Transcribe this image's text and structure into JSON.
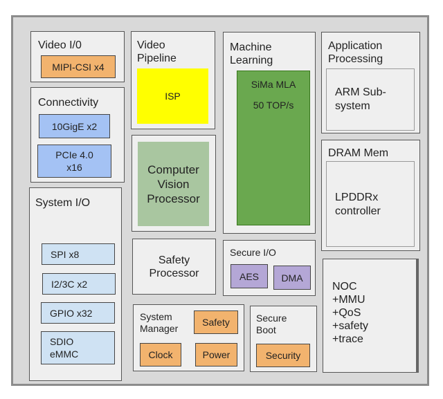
{
  "diagram": {
    "blocks": {
      "video_io": {
        "title": "Video I/0",
        "items": [
          "MIPI-CSI x4"
        ]
      },
      "connectivity": {
        "title": "Connectivity",
        "items": [
          "10GigE x2",
          "PCIe 4.0\nx16"
        ]
      },
      "system_io": {
        "title": "System I/O",
        "items": [
          "SPI x8",
          "I2/3C x2",
          "GPIO x32",
          "SDIO\neMMC"
        ]
      },
      "video_pipeline": {
        "title": "Video\nPipeline",
        "items": [
          "ISP"
        ]
      },
      "computer_vision": {
        "label": "Computer\nVision\nProcessor"
      },
      "safety_processor": {
        "label": "Safety\nProcessor"
      },
      "system_manager": {
        "title": "System\nManager",
        "items": [
          "Safety",
          "Clock",
          "Power"
        ]
      },
      "machine_learning": {
        "title": "Machine\nLearning",
        "mla_name": "SiMa MLA",
        "mla_perf": "50 TOP/s"
      },
      "secure_io": {
        "title": "Secure I/O",
        "items": [
          "AES",
          "DMA"
        ]
      },
      "secure_boot": {
        "title": "Secure\nBoot",
        "items": [
          "Security"
        ]
      },
      "application_processing": {
        "title": "Application\nProcessing",
        "inner": "ARM Sub-\nsystem"
      },
      "dram_mem": {
        "title": "DRAM Mem",
        "inner": "LPDDRx\ncontroller"
      },
      "noc": {
        "label": "NOC\n+MMU\n+QoS\n+safety\n+trace"
      }
    },
    "colors": {
      "orange": "#f2b36e",
      "blue": "#a4c2f4",
      "light_blue": "#cfe2f3",
      "purple": "#b4a7d6",
      "yellow": "#ffff00",
      "sage": "#a9c6a0",
      "green": "#6aa84f"
    }
  }
}
